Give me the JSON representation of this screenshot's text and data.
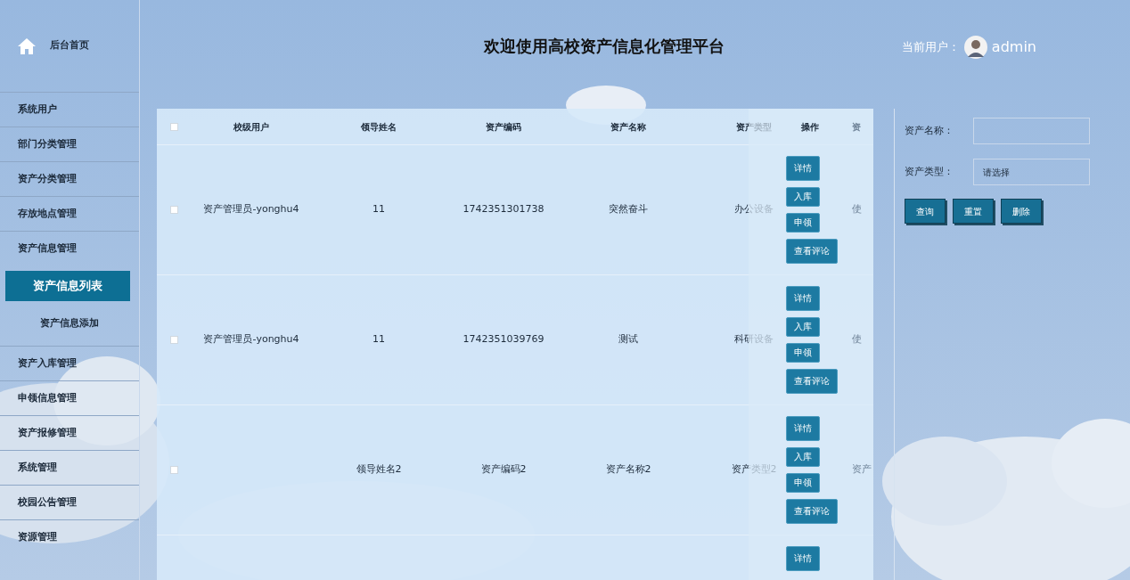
{
  "sidebar": {
    "home": "后台首页",
    "items": [
      {
        "label": "系统用户",
        "selected": false
      },
      {
        "label": "部门分类管理",
        "selected": false
      },
      {
        "label": "资产分类管理",
        "selected": false
      },
      {
        "label": "存放地点管理",
        "selected": false
      },
      {
        "label": "资产信息管理",
        "selected": false,
        "children": [
          {
            "label": "资产信息列表",
            "selected": true
          },
          {
            "label": "资产信息添加",
            "selected": false
          }
        ]
      },
      {
        "label": "资产入库管理",
        "selected": false
      },
      {
        "label": "申领信息管理",
        "selected": false
      },
      {
        "label": "资产报修管理",
        "selected": false
      },
      {
        "label": "系统管理",
        "selected": false
      },
      {
        "label": "校园公告管理",
        "selected": false
      },
      {
        "label": "资源管理",
        "selected": false
      }
    ]
  },
  "header": {
    "title": "欢迎使用高校资产信息化管理平台",
    "user_label": "当前用户：",
    "user": "admin"
  },
  "table": {
    "select_all_checked": false,
    "columns": [
      "校级用户",
      "领导姓名",
      "资产编码",
      "资产名称",
      "资产类型",
      "资"
    ],
    "ops_column": "操作",
    "rows": [
      {
        "checked": false,
        "cells": [
          "资产管理员-yonghu4",
          "11",
          "1742351301738",
          "突然奋斗",
          "办公设备",
          "使"
        ],
        "ops": [
          "详情",
          "入库",
          "申领",
          "查看评论"
        ]
      },
      {
        "checked": false,
        "cells": [
          "资产管理员-yonghu4",
          "11",
          "1742351039769",
          "测试",
          "科研设备",
          "使"
        ],
        "ops": [
          "详情",
          "入库",
          "申领",
          "查看评论"
        ]
      },
      {
        "checked": false,
        "cells": [
          "",
          "领导姓名2",
          "资产编码2",
          "资产名称2",
          "资产类型2",
          "资产"
        ],
        "ops": [
          "详情",
          "入库",
          "申领",
          "查看评论"
        ]
      },
      {
        "ops": [
          "详情"
        ]
      }
    ]
  },
  "search": {
    "fields": [
      {
        "label": "资产名称：",
        "kind": "text"
      },
      {
        "label": "资产类型：",
        "kind": "select",
        "value": "请选择"
      }
    ],
    "buttons": [
      "查询",
      "重置",
      "删除"
    ]
  }
}
